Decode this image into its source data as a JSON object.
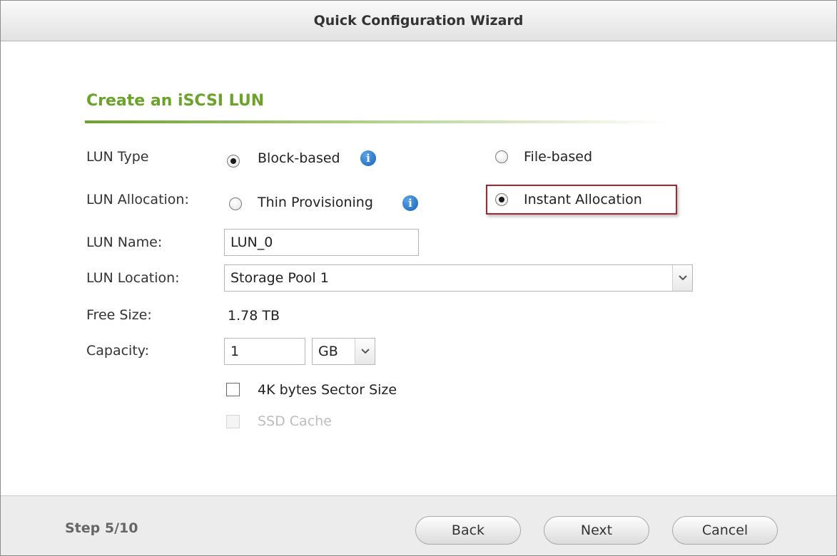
{
  "window": {
    "title": "Quick Configuration Wizard"
  },
  "section": {
    "title": "Create an iSCSI LUN"
  },
  "lun_type": {
    "label": "LUN Type",
    "options": [
      {
        "label": "Block-based",
        "selected": true,
        "has_info": true
      },
      {
        "label": "File-based",
        "selected": false
      }
    ]
  },
  "lun_allocation": {
    "label": "LUN Allocation:",
    "options": [
      {
        "label": "Thin Provisioning",
        "selected": false,
        "has_info": true
      },
      {
        "label": "Instant Allocation",
        "selected": true,
        "highlighted": true
      }
    ]
  },
  "lun_name": {
    "label": "LUN Name:",
    "value": "LUN_0"
  },
  "lun_location": {
    "label": "LUN Location:",
    "value": "Storage Pool 1"
  },
  "free_size": {
    "label": "Free Size:",
    "value": "1.78 TB"
  },
  "capacity": {
    "label": "Capacity:",
    "value": "1",
    "unit": "GB"
  },
  "options": {
    "sector_size": {
      "label": "4K bytes Sector Size",
      "checked": false,
      "enabled": true
    },
    "ssd_cache": {
      "label": "SSD Cache",
      "checked": false,
      "enabled": false
    }
  },
  "footer": {
    "step": "Step 5/10",
    "back_label": "Back",
    "next_label": "Next",
    "cancel_label": "Cancel"
  },
  "colors": {
    "section_title": "#6ba32a",
    "highlight_border": "#a6282d",
    "info_icon": "#1463b8"
  },
  "icons": {
    "info": "info-icon",
    "dropdown": "chevron-down-icon"
  }
}
